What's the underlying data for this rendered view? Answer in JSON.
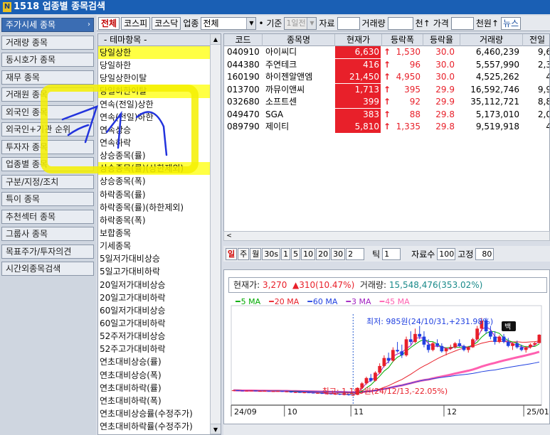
{
  "window": {
    "title": "1518 업종별 종목검색",
    "icon_text": "N"
  },
  "sidebar": {
    "items": [
      {
        "label": "주가시세 종목",
        "active": true
      },
      {
        "label": "거래량 종목",
        "active": false
      },
      {
        "label": "동시호가 종목",
        "active": false
      },
      {
        "label": "재무 종목",
        "active": false
      },
      {
        "label": "거래원 종목",
        "active": false
      },
      {
        "label": "외국인 종목",
        "active": false
      },
      {
        "label": "외국인+기관 순위",
        "active": false
      },
      {
        "label": "투자자 종목",
        "active": false
      },
      {
        "label": "업종별 종목",
        "active": false
      },
      {
        "label": "구분/지정/조치",
        "active": false
      },
      {
        "label": "특이 종목",
        "active": false
      },
      {
        "label": "추천섹터 종목",
        "active": false
      },
      {
        "label": "그룹사 종목",
        "active": false
      },
      {
        "label": "목표주가/투자의견",
        "active": false
      },
      {
        "label": "시간외종목검색",
        "active": false
      }
    ]
  },
  "toolbar": {
    "market_all": "전체",
    "kospi": "코스피",
    "kosdaq": "코스닥",
    "sector_label": "업종",
    "sector_value": "전체",
    "basis_label": "기준",
    "basis_value": "1일전",
    "material_label": "자료",
    "volume_label": "거래량",
    "volume_unit": "천↑",
    "price_label": "가격",
    "price_unit": "천원↑",
    "news_label": "뉴스"
  },
  "themes": {
    "header": "- 테마항목 -",
    "items": [
      {
        "label": "당일상한",
        "state": "hl"
      },
      {
        "label": "당일하한",
        "state": ""
      },
      {
        "label": "당일상한이탈",
        "state": ""
      },
      {
        "label": "당일하한이탈",
        "state": "hl"
      },
      {
        "label": "연속(전일)상한",
        "state": ""
      },
      {
        "label": "연속(전일)하한",
        "state": ""
      },
      {
        "label": "연속상승",
        "state": ""
      },
      {
        "label": "연속하락",
        "state": ""
      },
      {
        "label": "상승종목(률)",
        "state": ""
      },
      {
        "label": "상승종목(률)(상한제외)",
        "state": "hl"
      },
      {
        "label": "상승종목(폭)",
        "state": ""
      },
      {
        "label": "하락종목(률)",
        "state": ""
      },
      {
        "label": "하락종목(률)(하한제외)",
        "state": ""
      },
      {
        "label": "하락종목(폭)",
        "state": ""
      },
      {
        "label": "보합종목",
        "state": ""
      },
      {
        "label": "기세종목",
        "state": ""
      },
      {
        "label": "5일저가대비상승",
        "state": ""
      },
      {
        "label": "5일고가대비하락",
        "state": ""
      },
      {
        "label": "20일저가대비상승",
        "state": ""
      },
      {
        "label": "20일고가대비하락",
        "state": ""
      },
      {
        "label": "60일저가대비상승",
        "state": ""
      },
      {
        "label": "60일고가대비하락",
        "state": ""
      },
      {
        "label": "52주저가대비상승",
        "state": ""
      },
      {
        "label": "52주고가대비하락",
        "state": ""
      },
      {
        "label": "연초대비상승(률)",
        "state": ""
      },
      {
        "label": "연초대비상승(폭)",
        "state": ""
      },
      {
        "label": "연초대비하락(률)",
        "state": ""
      },
      {
        "label": "연초대비하락(폭)",
        "state": ""
      },
      {
        "label": "연초대비상승률(수정주가)",
        "state": ""
      },
      {
        "label": "연초대비하락률(수정주가)",
        "state": ""
      }
    ]
  },
  "stocks": {
    "columns": [
      "코드",
      "종목명",
      "현재가",
      "등락폭",
      "등락율",
      "거래량",
      "전일"
    ],
    "rows": [
      {
        "code": "040910",
        "name": "아이씨디",
        "price": "6,630",
        "arrow": "↑",
        "change": "1,530",
        "rate": "30.0",
        "volume": "6,460,239",
        "prev": "9,6"
      },
      {
        "code": "044380",
        "name": "주연테크",
        "price": "416",
        "arrow": "↑",
        "change": "96",
        "rate": "30.0",
        "volume": "5,557,990",
        "prev": "2,3"
      },
      {
        "code": "160190",
        "name": "하이젠알앤엠",
        "price": "21,450",
        "arrow": "↑",
        "change": "4,950",
        "rate": "30.0",
        "volume": "4,525,262",
        "prev": "4"
      },
      {
        "code": "013700",
        "name": "까뮤이앤씨",
        "price": "1,713",
        "arrow": "↑",
        "change": "395",
        "rate": "29.9",
        "volume": "16,592,746",
        "prev": "9,9"
      },
      {
        "code": "032680",
        "name": "소프트센",
        "price": "399",
        "arrow": "↑",
        "change": "92",
        "rate": "29.9",
        "volume": "35,112,721",
        "prev": "8,8"
      },
      {
        "code": "049470",
        "name": "SGA",
        "price": "383",
        "arrow": "↑",
        "change": "88",
        "rate": "29.8",
        "volume": "5,173,010",
        "prev": "2,0"
      },
      {
        "code": "089790",
        "name": "제이티",
        "price": "5,810",
        "arrow": "↑",
        "change": "1,335",
        "rate": "29.8",
        "volume": "9,519,918",
        "prev": "4"
      }
    ]
  },
  "chart_controls": {
    "periods": [
      "일",
      "주",
      "월",
      "30s",
      "1",
      "5",
      "10",
      "20",
      "30"
    ],
    "period_value": "2",
    "tick_label": "틱",
    "tick_value": "1",
    "count_label": "자료수",
    "count_value": "100",
    "fixed_label": "고정",
    "fixed_value": "80"
  },
  "chart_info": {
    "price_label": "현재가:",
    "price_value": "3,270",
    "change_value": "▲310(10.47%)",
    "volume_label": "거래량:",
    "volume_value": "15,548,476(353.02%)"
  },
  "chart_data": {
    "type": "candlestick",
    "ma_legend": [
      {
        "label": "5 MA",
        "color": "#00aa00"
      },
      {
        "label": "20 MA",
        "color": "#e8202a"
      },
      {
        "label": "60 MA",
        "color": "#2040e0"
      },
      {
        "label": "3 MA",
        "color": "#a020c0"
      },
      {
        "label": "45 MA",
        "color": "#ff60b0"
      }
    ],
    "x_ticks": [
      "24/09",
      "10",
      "11",
      "12",
      "25/01"
    ],
    "max_annotation": "최저: 985원(24/10/31,+231.98%)",
    "min_annotation": "최고: 1,195원(24/12/13,-22.05%)",
    "badge": "백",
    "ylim": [
      900,
      4200
    ],
    "ohlc": [
      [
        1180,
        1200,
        1170,
        1190
      ],
      [
        1190,
        1195,
        1175,
        1180
      ],
      [
        1180,
        1190,
        1165,
        1170
      ],
      [
        1170,
        1185,
        1160,
        1175
      ],
      [
        1175,
        1190,
        1165,
        1180
      ],
      [
        1180,
        1185,
        1150,
        1160
      ],
      [
        1160,
        1175,
        1145,
        1165
      ],
      [
        1165,
        1180,
        1155,
        1170
      ],
      [
        1170,
        1175,
        1140,
        1150
      ],
      [
        1150,
        1165,
        1135,
        1155
      ],
      [
        1155,
        1170,
        1140,
        1160
      ],
      [
        1160,
        1170,
        1130,
        1140
      ],
      [
        1140,
        1155,
        1120,
        1145
      ],
      [
        1145,
        1150,
        1100,
        1110
      ],
      [
        1110,
        1130,
        1090,
        1120
      ],
      [
        1120,
        1135,
        1100,
        1105
      ],
      [
        1105,
        1120,
        1080,
        1110
      ],
      [
        1110,
        1125,
        1095,
        1100
      ],
      [
        1100,
        1115,
        1070,
        1085
      ],
      [
        1085,
        1100,
        1060,
        1090
      ],
      [
        1090,
        1105,
        1050,
        1060
      ],
      [
        1060,
        1080,
        1040,
        1070
      ],
      [
        1070,
        1085,
        1030,
        1045
      ],
      [
        1045,
        1065,
        1020,
        1055
      ],
      [
        1055,
        1070,
        1010,
        1030
      ],
      [
        1030,
        1050,
        1000,
        1040
      ],
      [
        1040,
        1055,
        990,
        1010
      ],
      [
        1010,
        1030,
        985,
        1020
      ],
      [
        1020,
        1300,
        1010,
        1280
      ],
      [
        1280,
        1500,
        1250,
        1450
      ],
      [
        1450,
        1700,
        1400,
        1650
      ],
      [
        1650,
        1800,
        1500,
        1550
      ],
      [
        1550,
        1900,
        1520,
        1850
      ],
      [
        1850,
        2200,
        1800,
        2100
      ],
      [
        2100,
        2500,
        2050,
        2400
      ],
      [
        2400,
        2600,
        2200,
        2300
      ],
      [
        2300,
        2800,
        2250,
        2700
      ],
      [
        2700,
        3000,
        2600,
        2650
      ],
      [
        2650,
        2900,
        2400,
        2500
      ],
      [
        2500,
        3200,
        2450,
        3100
      ],
      [
        3100,
        3400,
        2900,
        3000
      ],
      [
        3000,
        3500,
        2950,
        3300
      ],
      [
        3300,
        3600,
        3100,
        3200
      ],
      [
        3200,
        3400,
        2800,
        2900
      ],
      [
        2900,
        3100,
        2600,
        2700
      ],
      [
        2700,
        3000,
        2650,
        2950
      ],
      [
        2950,
        3100,
        2800,
        2850
      ],
      [
        2850,
        2950,
        2600,
        2650
      ],
      [
        2650,
        2800,
        2500,
        2750
      ],
      [
        2750,
        2900,
        2700,
        2800
      ],
      [
        2800,
        3000,
        2750,
        2950
      ],
      [
        2950,
        3100,
        2800,
        2850
      ],
      [
        2850,
        2900,
        2650,
        2700
      ],
      [
        2700,
        2850,
        2600,
        2800
      ],
      [
        2800,
        3150,
        2780,
        3100
      ],
      [
        3100,
        3600,
        3050,
        3500
      ],
      [
        3500,
        3900,
        3400,
        3800
      ],
      [
        3800,
        3900,
        3300,
        3400
      ],
      [
        3400,
        3600,
        3100,
        3200
      ],
      [
        3200,
        3400,
        2900,
        3000
      ],
      [
        3000,
        3250,
        2950,
        3200
      ],
      [
        3200,
        3300,
        2950,
        3000
      ],
      [
        3000,
        3150,
        2800,
        2850
      ],
      [
        2850,
        3000,
        2700,
        2950
      ],
      [
        2950,
        3050,
        2750,
        2800
      ],
      [
        2800,
        2900,
        2650,
        2700
      ],
      [
        2700,
        2850,
        2600,
        2800
      ],
      [
        2800,
        2950,
        2750,
        2900
      ],
      [
        2900,
        3000,
        2850,
        2960
      ],
      [
        2960,
        3290,
        2940,
        3270
      ]
    ]
  }
}
